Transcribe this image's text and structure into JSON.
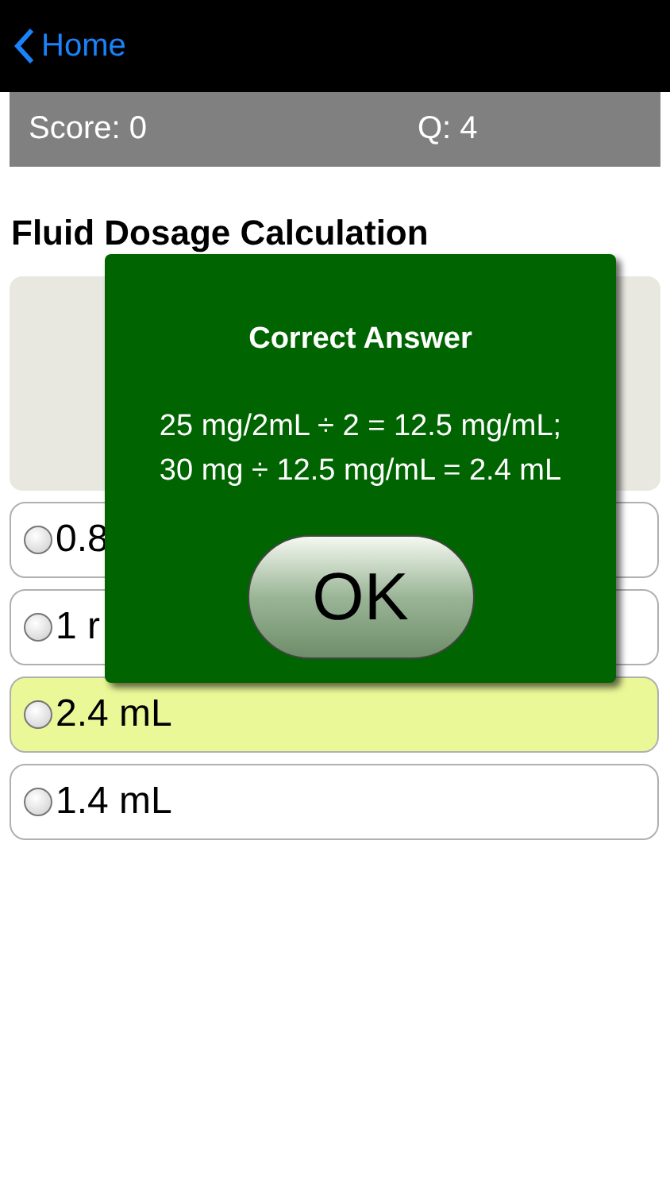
{
  "nav": {
    "back": "Home"
  },
  "score_bar": {
    "score": "Score: 0",
    "question": "Q: 4"
  },
  "title": "Fluid Dosage Calculation",
  "options": [
    {
      "label": "0.8",
      "selected": false
    },
    {
      "label": "1 r",
      "selected": false
    },
    {
      "label": "2.4 mL",
      "selected": true
    },
    {
      "label": "1.4 mL",
      "selected": false
    }
  ],
  "dialog": {
    "title": "Correct Answer",
    "lines": [
      "25 mg/2mL ÷ 2 = 12.5 mg/mL;",
      "30 mg ÷ 12.5 mg/mL = 2.4 mL"
    ],
    "button": "OK"
  }
}
